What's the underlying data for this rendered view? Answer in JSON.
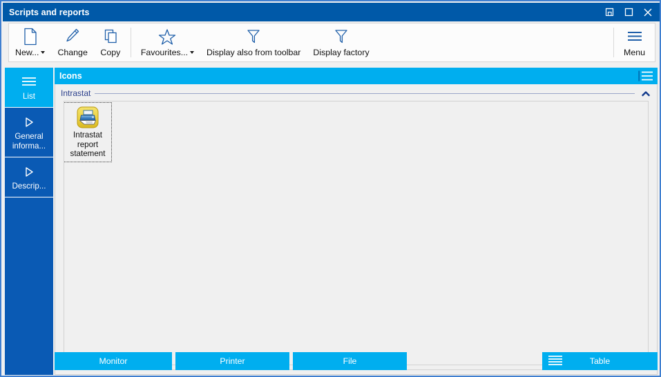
{
  "window": {
    "title": "Scripts and reports",
    "controls": [
      {
        "name": "restore-down-button",
        "label": "Restore Down"
      },
      {
        "name": "maximize-button",
        "label": "Maximize"
      },
      {
        "name": "close-button",
        "label": "Close"
      }
    ]
  },
  "toolbar": {
    "items": [
      {
        "id": "new",
        "label": "New...",
        "icon": "document-icon",
        "dropdown": true
      },
      {
        "id": "change",
        "label": "Change",
        "icon": "pencil-icon",
        "dropdown": false
      },
      {
        "id": "copy",
        "label": "Copy",
        "icon": "copy-icon",
        "dropdown": false
      },
      {
        "id": "favourites",
        "label": "Favourites...",
        "icon": "star-icon",
        "dropdown": true
      },
      {
        "id": "display-also-from-toolbar",
        "label": "Display also from toolbar",
        "icon": "filter-icon",
        "dropdown": false
      },
      {
        "id": "display-factory",
        "label": "Display factory",
        "icon": "filter-icon",
        "dropdown": false
      }
    ],
    "menu": {
      "label": "Menu",
      "icon": "hamburger-icon"
    }
  },
  "sidebar": {
    "items": [
      {
        "id": "list",
        "label": "List",
        "icon": "hamburger-icon",
        "active": true
      },
      {
        "id": "general-information",
        "label": "General\ninforma...",
        "icon": "triangle-right-icon",
        "active": false
      },
      {
        "id": "description",
        "label": "Descrip...",
        "icon": "triangle-right-icon",
        "active": false
      }
    ]
  },
  "panel": {
    "title": "Icons",
    "menu_icon": "panel-menu-icon",
    "group": {
      "label": "Intrastat",
      "collapse_icon": "chevron-up-icon"
    },
    "icons": [
      {
        "id": "intrastat-report-statement",
        "label": "Intrastat\nreport\nstatement",
        "icon": "printer-icon",
        "selected": true
      }
    ]
  },
  "bottom_bar": {
    "buttons": [
      {
        "id": "monitor",
        "label": "Monitor"
      },
      {
        "id": "printer",
        "label": "Printer"
      },
      {
        "id": "file",
        "label": "File"
      },
      {
        "id": "table",
        "label": "Table",
        "icon": "table-lines-icon"
      }
    ]
  },
  "colors": {
    "title_bar": "#0059a8",
    "accent_cyan": "#00aeef",
    "sidebar_blue": "#0a5ab4",
    "window_border": "#3f7fd0",
    "icon_badge_yellow": "#e8d24a",
    "group_label": "#2b3f8c",
    "panel_bg": "#f0f0f0"
  }
}
